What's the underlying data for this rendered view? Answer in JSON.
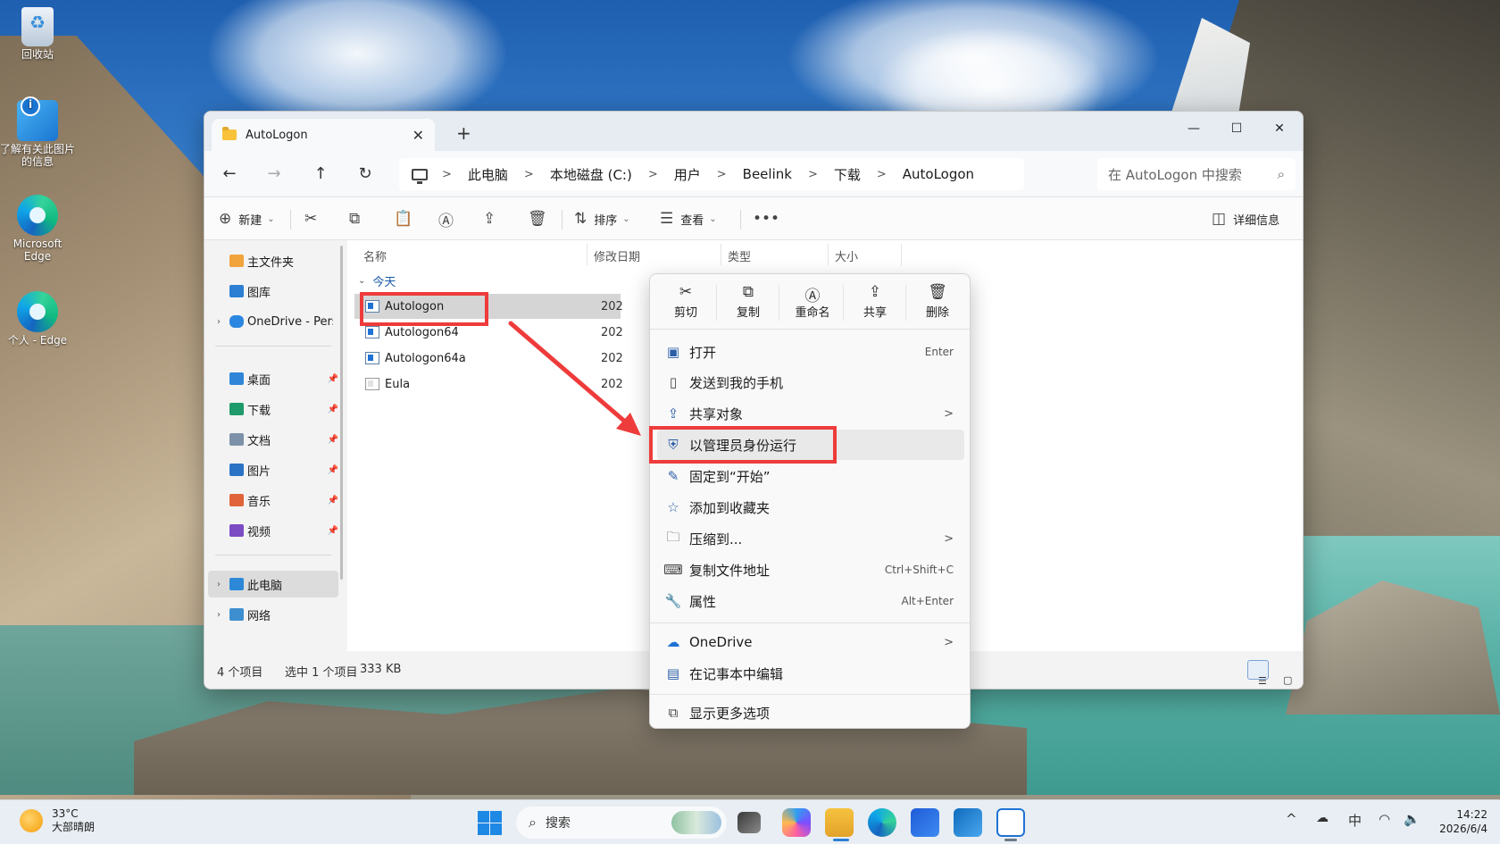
{
  "desktop": {
    "icons": [
      {
        "label": "回收站"
      },
      {
        "label": "了解有关此图片的信息"
      },
      {
        "label": "Microsoft Edge"
      },
      {
        "label": "个人 - Edge"
      }
    ]
  },
  "window": {
    "tab_title": "AutoLogon",
    "tab_close": "✕",
    "new_tab": "+",
    "controls": {
      "minimize": "—",
      "maximize": "☐",
      "close": "✕"
    },
    "nav": {
      "back": "←",
      "forward": "→",
      "up": "↑",
      "refresh": "↻"
    },
    "breadcrumb": [
      "此电脑",
      "本地磁盘 (C:)",
      "用户",
      "Beelink",
      "下载",
      "AutoLogon"
    ],
    "breadcrumb_sep": ">",
    "search_placeholder": "在 AutoLogon 中搜索",
    "toolbar": {
      "new_label": "新建",
      "sort_label": "排序",
      "view_label": "查看",
      "more": "•••",
      "details_label": "详细信息"
    },
    "sidebar": {
      "items": [
        {
          "label": "主文件夹",
          "pinned": false
        },
        {
          "label": "图库",
          "pinned": false
        },
        {
          "label": "OneDrive - Pers",
          "pinned": false
        }
      ],
      "quick_access": [
        {
          "label": "桌面"
        },
        {
          "label": "下载"
        },
        {
          "label": "文档"
        },
        {
          "label": "图片"
        },
        {
          "label": "音乐"
        },
        {
          "label": "视频"
        }
      ],
      "locations": [
        {
          "label": "此电脑"
        },
        {
          "label": "网络"
        }
      ]
    },
    "columns": {
      "name": "名称",
      "date": "修改日期",
      "type": "类型",
      "size": "大小"
    },
    "group_label": "今天",
    "files": [
      {
        "name": "Autologon",
        "date": "202",
        "selected": true
      },
      {
        "name": "Autologon64",
        "date": "202",
        "selected": false
      },
      {
        "name": "Autologon64a",
        "date": "202",
        "selected": false
      },
      {
        "name": "Eula",
        "date": "202",
        "selected": false
      }
    ],
    "status": {
      "count": "4 个项目",
      "selection": "选中 1 个项目",
      "size": "333 KB"
    }
  },
  "context_menu": {
    "quick_actions": [
      {
        "label": "剪切",
        "icon": "scissors-icon"
      },
      {
        "label": "复制",
        "icon": "copy-icon"
      },
      {
        "label": "重命名",
        "icon": "rename-icon"
      },
      {
        "label": "共享",
        "icon": "share-icon"
      },
      {
        "label": "删除",
        "icon": "trash-icon"
      }
    ],
    "items": [
      {
        "label": "打开",
        "shortcut": "Enter",
        "submenu": false
      },
      {
        "label": "发送到我的手机",
        "shortcut": "",
        "submenu": false
      },
      {
        "label": "共享对象",
        "shortcut": "",
        "submenu": true
      },
      {
        "label": "以管理员身份运行",
        "shortcut": "",
        "submenu": false
      },
      {
        "label": "固定到“开始”",
        "shortcut": "",
        "submenu": false
      },
      {
        "label": "添加到收藏夹",
        "shortcut": "",
        "submenu": false
      },
      {
        "label": "压缩到...",
        "shortcut": "",
        "submenu": true
      },
      {
        "label": "复制文件地址",
        "shortcut": "Ctrl+Shift+C",
        "submenu": false
      },
      {
        "label": "属性",
        "shortcut": "Alt+Enter",
        "submenu": false
      }
    ],
    "extra_items": [
      {
        "label": "OneDrive",
        "submenu": true
      },
      {
        "label": "在记事本中编辑",
        "submenu": false
      }
    ],
    "more_options": "显示更多选项",
    "submenu_arrow": ">"
  },
  "taskbar": {
    "weather_temp": "33°C",
    "weather_desc": "大部晴朗",
    "search_label": "搜索",
    "tray": {
      "chevron": "^",
      "ime": "中",
      "wifi": "wifi-icon",
      "volume": "volume-icon"
    },
    "time": "14:22",
    "date": "2026/6/4"
  },
  "colors": {
    "highlight_red": "#ee3b3b",
    "accent_blue": "#1f72d4"
  }
}
